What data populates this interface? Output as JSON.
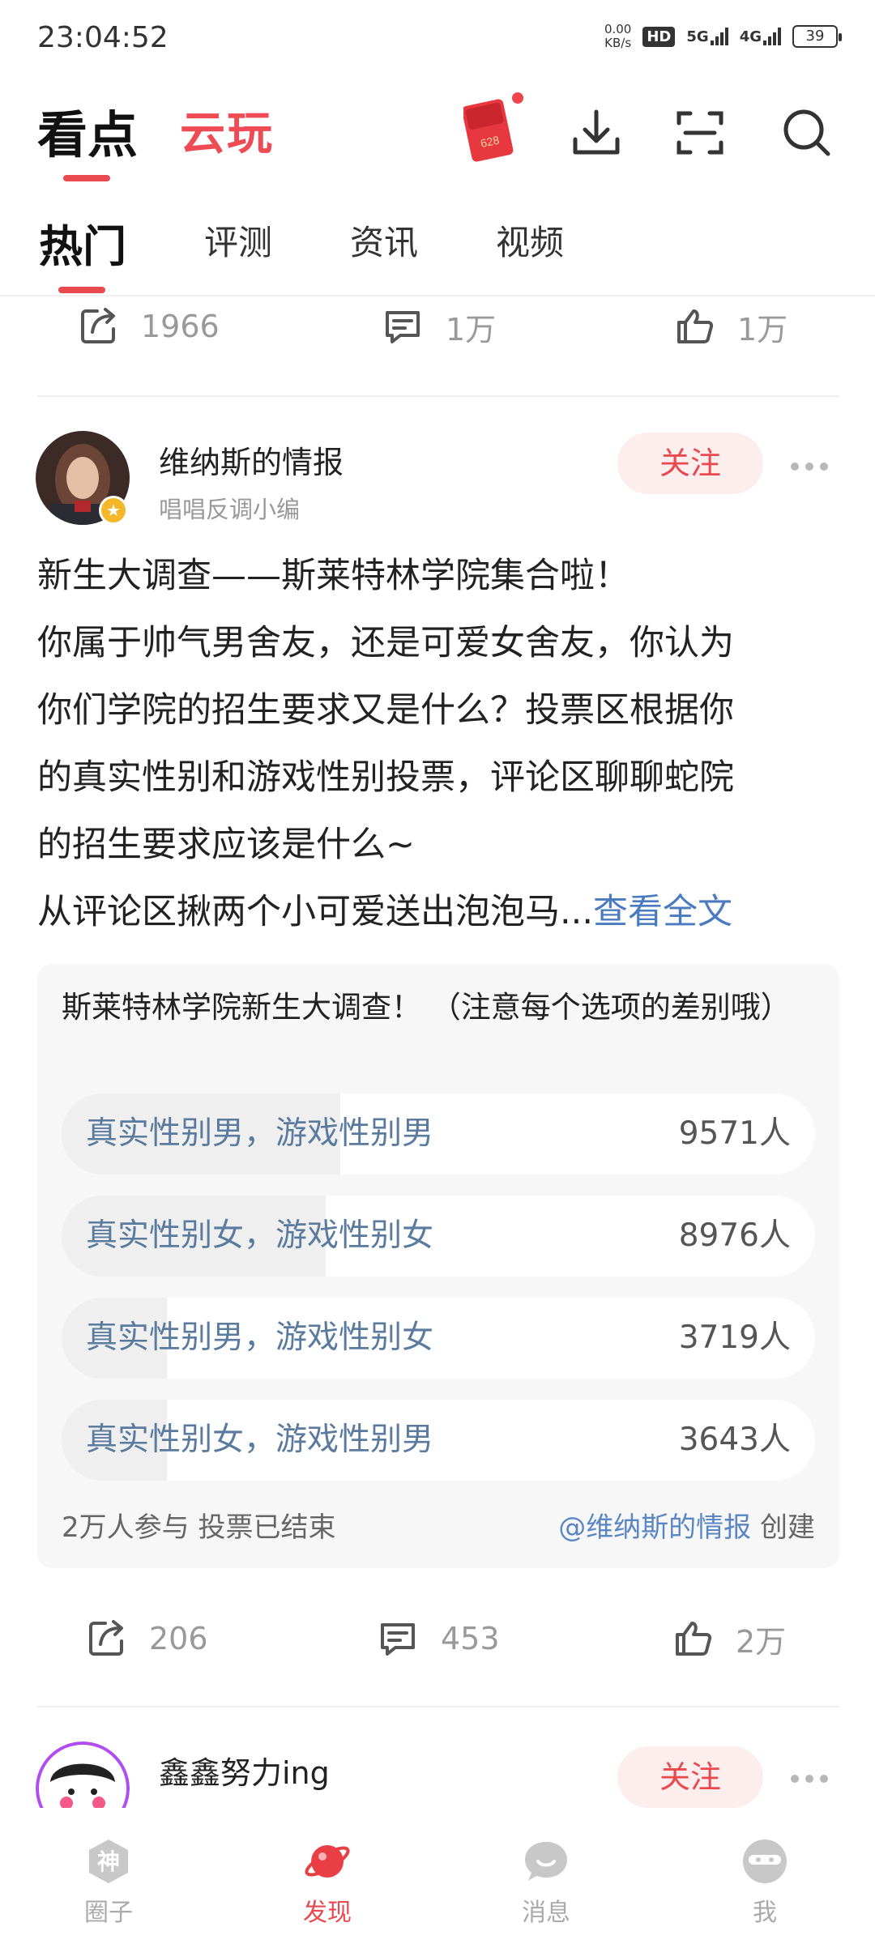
{
  "status_bar": {
    "time": "23:04:52",
    "net_speed_value": "0.00",
    "net_speed_unit": "KB/s",
    "hd": "HD",
    "network_1": "5G",
    "network_2": "4G",
    "battery": "39"
  },
  "header": {
    "tab_active": "看点",
    "tab_other": "云玩",
    "redpack_number": "628",
    "icons": [
      "redpack-icon",
      "download-icon",
      "scan-icon",
      "search-icon"
    ]
  },
  "sub_tabs": {
    "items": [
      "热门",
      "评测",
      "资讯",
      "视频"
    ],
    "active_index": 0
  },
  "prev_post_actions": {
    "share": "1966",
    "comment": "1万",
    "like": "1万"
  },
  "post": {
    "author": "维纳斯的情报",
    "author_sub": "唱唱反调小编",
    "follow_label": "关注",
    "text_lines": [
      "新生大调查——斯莱特林学院集合啦！",
      "你属于帅气男舍友，还是可爱女舍友，你认为",
      "你们学院的招生要求又是什么？投票区根据你",
      "的真实性别和游戏性别投票，评论区聊聊蛇院",
      "的招生要求应该是什么~"
    ],
    "last_line": "从评论区揪两个小可爱送出泡泡马...",
    "view_full": "查看全文",
    "poll": {
      "title": "斯莱特林学院新生大调查！ （注意每个选项的差别哦）",
      "options": [
        {
          "label": "真实性别男，游戏性别男",
          "count": "9571人",
          "fraction": 0.37
        },
        {
          "label": "真实性别女，游戏性别女",
          "count": "8976人",
          "fraction": 0.35
        },
        {
          "label": "真实性别男，游戏性别女",
          "count": "3719人",
          "fraction": 0.14
        },
        {
          "label": "真实性别女，游戏性别男",
          "count": "3643人",
          "fraction": 0.14
        }
      ],
      "participants": "2万人参与 投票已结束",
      "creator": "@维纳斯的情报",
      "created_label": "创建"
    },
    "actions": {
      "share": "206",
      "comment": "453",
      "like": "2万"
    }
  },
  "next_post": {
    "author": "鑫鑫努力ing",
    "follow_label": "关注"
  },
  "bottom_nav": {
    "items": [
      {
        "label": "圈子",
        "icon_text": "神"
      },
      {
        "label": "发现"
      },
      {
        "label": "消息"
      },
      {
        "label": "我"
      }
    ],
    "active_index": 1
  },
  "colors": {
    "accent": "#e84a4f",
    "link": "#4a7bc0",
    "poll_label": "#5a7a9e"
  }
}
